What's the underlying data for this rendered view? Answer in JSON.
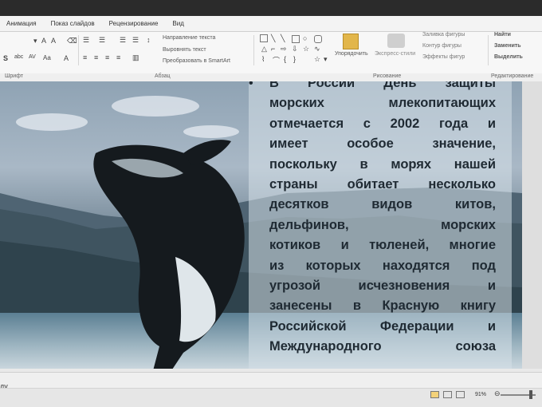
{
  "ribbon": {
    "tabs": [
      "Анимация",
      "Показ слайдов",
      "Рецензирование",
      "Вид"
    ],
    "paragraph": {
      "text_direction": "Направление текста",
      "align_text": "Выровнять текст",
      "convert_smartart": "Преобразовать в SmartArt"
    },
    "drawing": {
      "arrange": "Упорядочить",
      "quick_styles": "Экспресс-стили",
      "shape_fill": "Заливка фигуры",
      "shape_outline": "Контур фигуры",
      "shape_effects": "Эффекты фигур"
    },
    "editing": {
      "find": "Найти",
      "replace": "Заменить",
      "select": "Выделить"
    },
    "groups": {
      "font": "Шрифт",
      "paragraph": "Абзац",
      "drawing": "Рисование",
      "editing": "Редактирование"
    }
  },
  "slide": {
    "bullet": "•",
    "lines": [
      "В России День защиты",
      "морских млекопитающих",
      "отмечается с 2002 года и",
      "имеет особое значение,",
      "поскольку в морях нашей",
      "страны обитает несколько",
      "десятков видов китов,",
      "дельфинов, морских",
      "котиков и тюленей, многие",
      "из которых находятся под",
      "угрозой исчезновения и",
      "занесены в Красную книгу",
      "Российской Федерации и",
      "Международного союза"
    ]
  },
  "statusbar": {
    "left_text": "ду",
    "zoom": "91%"
  }
}
